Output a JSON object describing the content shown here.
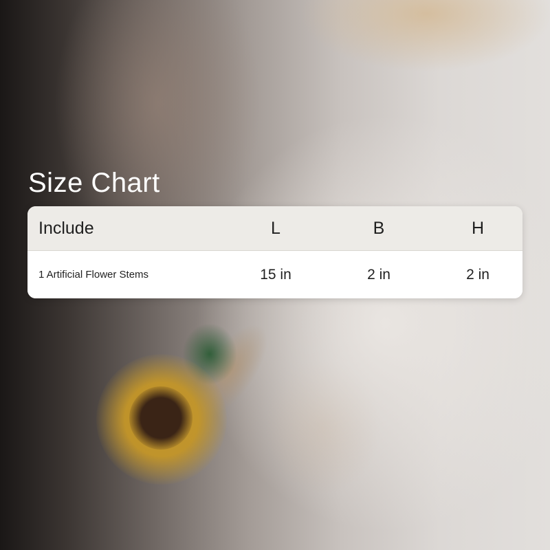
{
  "title": "Size Chart",
  "table": {
    "headers": [
      "Include",
      "L",
      "B",
      "H"
    ],
    "rows": [
      [
        "1 Artificial Flower Stems",
        "15 in",
        "2 in",
        "2 in"
      ]
    ]
  },
  "colors": {
    "header_bg": "#edebe7",
    "row_bg": "#ffffff",
    "title_text": "#ffffff",
    "cell_text": "#1f1f1f"
  }
}
